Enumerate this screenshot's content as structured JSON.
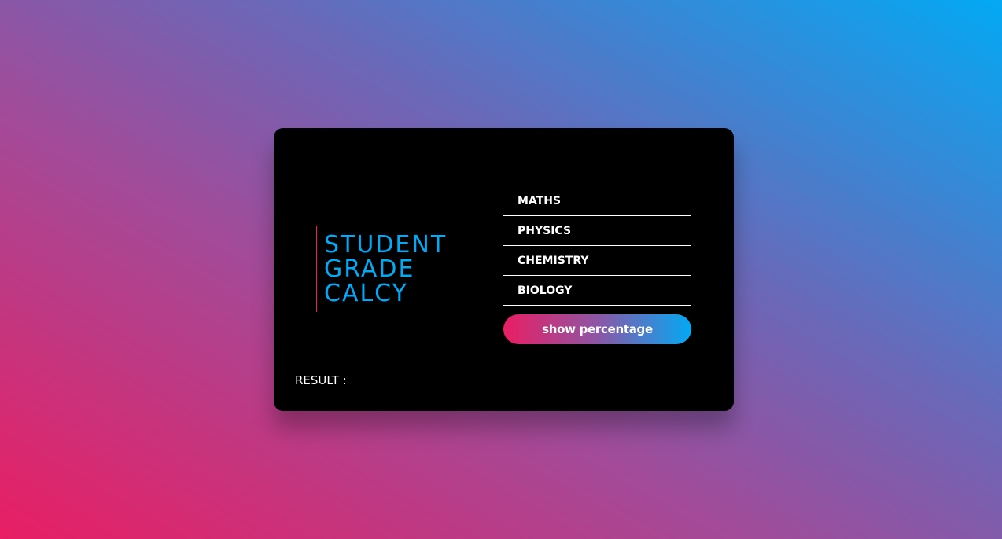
{
  "colors": {
    "card_background": "#000000",
    "title": "#03a9f4",
    "title_border": "#e91e63",
    "text": "#ffffff",
    "background_gradient": [
      "#e91e63",
      "#03a9f4"
    ],
    "button_gradient": [
      "#e91e63",
      "#03a9f4"
    ]
  },
  "title": {
    "lines": [
      "STUDENT",
      "GRADE",
      "CALCY"
    ]
  },
  "inputs": {
    "maths": {
      "placeholder": "MATHS",
      "value": ""
    },
    "physics": {
      "placeholder": "PHYSICS",
      "value": ""
    },
    "chemistry": {
      "placeholder": "CHEMISTRY",
      "value": ""
    },
    "biology": {
      "placeholder": "BIOLOGY",
      "value": ""
    }
  },
  "button": {
    "label": "show percentage"
  },
  "result": {
    "label": "RESULT :",
    "value": ""
  }
}
